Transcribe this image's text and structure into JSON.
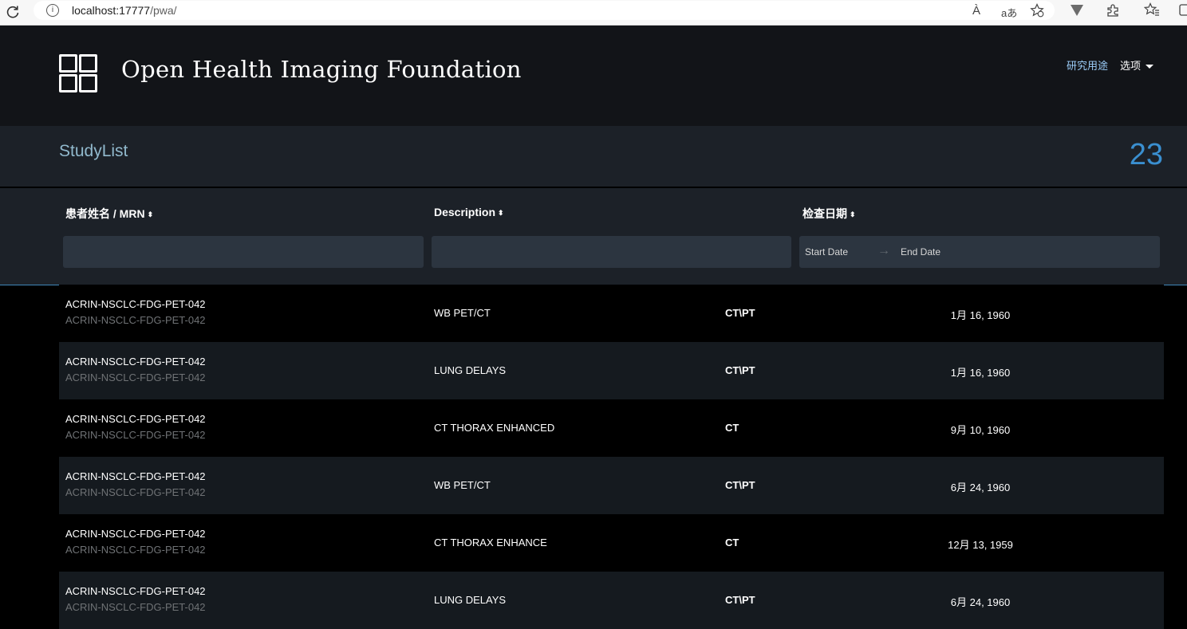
{
  "browser": {
    "url_host": "localhost:17777",
    "url_path": "/pwa/",
    "reload_icon": "reload-icon",
    "toolbar_icons": [
      "read-aloud-icon",
      "translate-icon",
      "favorite-add-icon",
      "extension-v-icon",
      "extensions-icon",
      "favorites-icon",
      "collections-icon"
    ],
    "read_aloud_glyph": "À",
    "translate_glyph": "aあ"
  },
  "header": {
    "brand": "Open Health Imaging Foundation",
    "research_link": "研究用途",
    "options_label": "选项"
  },
  "studylist": {
    "title": "StudyList",
    "count": "23"
  },
  "filters": {
    "col_patient": "患者姓名 / MRN",
    "col_description": "Description",
    "col_date": "检查日期",
    "sort_glyph": "⬍",
    "patient_value": "",
    "description_value": "",
    "start_date_placeholder": "Start Date",
    "end_date_placeholder": "End Date",
    "arrow_glyph": "→"
  },
  "rows": [
    {
      "name": "ACRIN-NSCLC-FDG-PET-042",
      "mrn": "ACRIN-NSCLC-FDG-PET-042",
      "description": "WB PET/CT",
      "modality": "CT\\PT",
      "date": "1月 16, 1960"
    },
    {
      "name": "ACRIN-NSCLC-FDG-PET-042",
      "mrn": "ACRIN-NSCLC-FDG-PET-042",
      "description": "LUNG DELAYS",
      "modality": "CT\\PT",
      "date": "1月 16, 1960"
    },
    {
      "name": "ACRIN-NSCLC-FDG-PET-042",
      "mrn": "ACRIN-NSCLC-FDG-PET-042",
      "description": "CT THORAX ENHANCED",
      "modality": "CT",
      "date": "9月 10, 1960"
    },
    {
      "name": "ACRIN-NSCLC-FDG-PET-042",
      "mrn": "ACRIN-NSCLC-FDG-PET-042",
      "description": "WB PET/CT",
      "modality": "CT\\PT",
      "date": "6月 24, 1960"
    },
    {
      "name": "ACRIN-NSCLC-FDG-PET-042",
      "mrn": "ACRIN-NSCLC-FDG-PET-042",
      "description": "CT THORAX ENHANCE",
      "modality": "CT",
      "date": "12月 13, 1959"
    },
    {
      "name": "ACRIN-NSCLC-FDG-PET-042",
      "mrn": "ACRIN-NSCLC-FDG-PET-042",
      "description": "LUNG DELAYS",
      "modality": "CT\\PT",
      "date": "6月 24, 1960"
    }
  ]
}
